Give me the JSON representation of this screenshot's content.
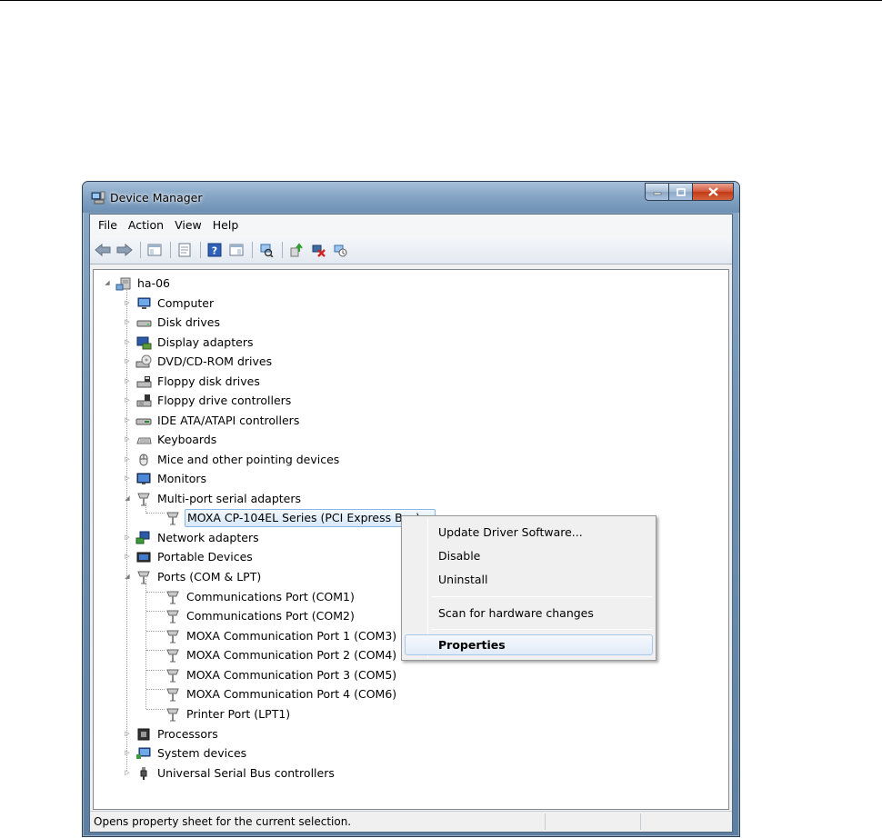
{
  "window": {
    "title": "Device Manager",
    "icons": {
      "app": "device-manager-icon",
      "minimize": "minimize-icon",
      "maximize": "maximize-icon",
      "close": "close-icon"
    }
  },
  "menu": [
    "File",
    "Action",
    "View",
    "Help"
  ],
  "toolbar": {
    "buttons": [
      "back-arrow-icon",
      "forward-arrow-icon",
      "show-hide-console-tree-icon",
      "properties-icon",
      "help-icon",
      "show-action-pane-icon",
      "scan-hardware-changes-icon",
      "update-driver-icon",
      "uninstall-icon",
      "disable-device-icon"
    ]
  },
  "tree": {
    "root": "ha-06",
    "categories": [
      "Computer",
      "Disk drives",
      "Display adapters",
      "DVD/CD-ROM drives",
      "Floppy disk drives",
      "Floppy drive controllers",
      "IDE ATA/ATAPI controllers",
      "Keyboards",
      "Mice and other pointing devices",
      "Monitors",
      "Multi-port serial adapters",
      "Network adapters",
      "Portable Devices",
      "Ports (COM & LPT)",
      "Processors",
      "System devices",
      "Universal Serial Bus controllers"
    ],
    "multiport_children": [
      "MOXA CP-104EL Series (PCI Express Bus)"
    ],
    "ports_children": [
      "Communications Port (COM1)",
      "Communications Port (COM2)",
      "MOXA Communication Port 1 (COM3)",
      "MOXA Communication Port 2 (COM4)",
      "MOXA Communication Port 3 (COM5)",
      "MOXA Communication Port 4 (COM6)",
      "Printer Port (LPT1)"
    ]
  },
  "context_menu": {
    "items": [
      "Update Driver Software...",
      "Disable",
      "Uninstall",
      "Scan for hardware changes",
      "Properties"
    ]
  },
  "status": {
    "text": "Opens property sheet for the current selection."
  }
}
